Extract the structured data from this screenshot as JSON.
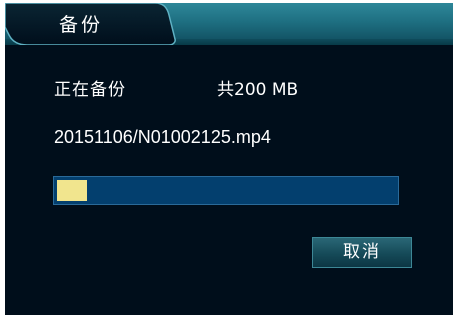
{
  "dialog": {
    "title": "备份",
    "status_label": "正在备份",
    "total_size": "共200 MB",
    "file_path": "20151106/N01002125.mp4",
    "progress_fraction": 0.09,
    "cancel_label": "取消"
  },
  "colors": {
    "background": "#000e1b",
    "title_bar": "#1e6f81",
    "progress_track": "#033f6e",
    "progress_fill": "#f1e58e",
    "text": "#ffffff"
  }
}
